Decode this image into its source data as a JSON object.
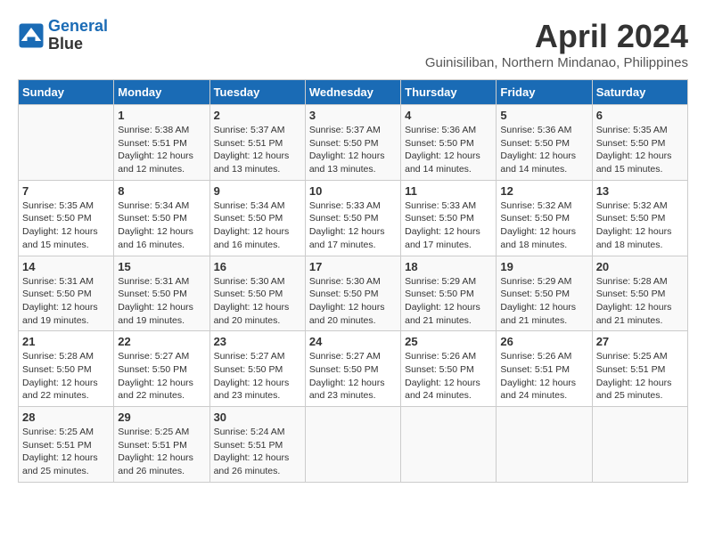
{
  "header": {
    "logo_line1": "General",
    "logo_line2": "Blue",
    "title": "April 2024",
    "subtitle": "Guinisiliban, Northern Mindanao, Philippines"
  },
  "weekdays": [
    "Sunday",
    "Monday",
    "Tuesday",
    "Wednesday",
    "Thursday",
    "Friday",
    "Saturday"
  ],
  "weeks": [
    [
      {
        "day": "",
        "sunrise": "",
        "sunset": "",
        "daylight": ""
      },
      {
        "day": "1",
        "sunrise": "Sunrise: 5:38 AM",
        "sunset": "Sunset: 5:51 PM",
        "daylight": "Daylight: 12 hours and 12 minutes."
      },
      {
        "day": "2",
        "sunrise": "Sunrise: 5:37 AM",
        "sunset": "Sunset: 5:51 PM",
        "daylight": "Daylight: 12 hours and 13 minutes."
      },
      {
        "day": "3",
        "sunrise": "Sunrise: 5:37 AM",
        "sunset": "Sunset: 5:50 PM",
        "daylight": "Daylight: 12 hours and 13 minutes."
      },
      {
        "day": "4",
        "sunrise": "Sunrise: 5:36 AM",
        "sunset": "Sunset: 5:50 PM",
        "daylight": "Daylight: 12 hours and 14 minutes."
      },
      {
        "day": "5",
        "sunrise": "Sunrise: 5:36 AM",
        "sunset": "Sunset: 5:50 PM",
        "daylight": "Daylight: 12 hours and 14 minutes."
      },
      {
        "day": "6",
        "sunrise": "Sunrise: 5:35 AM",
        "sunset": "Sunset: 5:50 PM",
        "daylight": "Daylight: 12 hours and 15 minutes."
      }
    ],
    [
      {
        "day": "7",
        "sunrise": "Sunrise: 5:35 AM",
        "sunset": "Sunset: 5:50 PM",
        "daylight": "Daylight: 12 hours and 15 minutes."
      },
      {
        "day": "8",
        "sunrise": "Sunrise: 5:34 AM",
        "sunset": "Sunset: 5:50 PM",
        "daylight": "Daylight: 12 hours and 16 minutes."
      },
      {
        "day": "9",
        "sunrise": "Sunrise: 5:34 AM",
        "sunset": "Sunset: 5:50 PM",
        "daylight": "Daylight: 12 hours and 16 minutes."
      },
      {
        "day": "10",
        "sunrise": "Sunrise: 5:33 AM",
        "sunset": "Sunset: 5:50 PM",
        "daylight": "Daylight: 12 hours and 17 minutes."
      },
      {
        "day": "11",
        "sunrise": "Sunrise: 5:33 AM",
        "sunset": "Sunset: 5:50 PM",
        "daylight": "Daylight: 12 hours and 17 minutes."
      },
      {
        "day": "12",
        "sunrise": "Sunrise: 5:32 AM",
        "sunset": "Sunset: 5:50 PM",
        "daylight": "Daylight: 12 hours and 18 minutes."
      },
      {
        "day": "13",
        "sunrise": "Sunrise: 5:32 AM",
        "sunset": "Sunset: 5:50 PM",
        "daylight": "Daylight: 12 hours and 18 minutes."
      }
    ],
    [
      {
        "day": "14",
        "sunrise": "Sunrise: 5:31 AM",
        "sunset": "Sunset: 5:50 PM",
        "daylight": "Daylight: 12 hours and 19 minutes."
      },
      {
        "day": "15",
        "sunrise": "Sunrise: 5:31 AM",
        "sunset": "Sunset: 5:50 PM",
        "daylight": "Daylight: 12 hours and 19 minutes."
      },
      {
        "day": "16",
        "sunrise": "Sunrise: 5:30 AM",
        "sunset": "Sunset: 5:50 PM",
        "daylight": "Daylight: 12 hours and 20 minutes."
      },
      {
        "day": "17",
        "sunrise": "Sunrise: 5:30 AM",
        "sunset": "Sunset: 5:50 PM",
        "daylight": "Daylight: 12 hours and 20 minutes."
      },
      {
        "day": "18",
        "sunrise": "Sunrise: 5:29 AM",
        "sunset": "Sunset: 5:50 PM",
        "daylight": "Daylight: 12 hours and 21 minutes."
      },
      {
        "day": "19",
        "sunrise": "Sunrise: 5:29 AM",
        "sunset": "Sunset: 5:50 PM",
        "daylight": "Daylight: 12 hours and 21 minutes."
      },
      {
        "day": "20",
        "sunrise": "Sunrise: 5:28 AM",
        "sunset": "Sunset: 5:50 PM",
        "daylight": "Daylight: 12 hours and 21 minutes."
      }
    ],
    [
      {
        "day": "21",
        "sunrise": "Sunrise: 5:28 AM",
        "sunset": "Sunset: 5:50 PM",
        "daylight": "Daylight: 12 hours and 22 minutes."
      },
      {
        "day": "22",
        "sunrise": "Sunrise: 5:27 AM",
        "sunset": "Sunset: 5:50 PM",
        "daylight": "Daylight: 12 hours and 22 minutes."
      },
      {
        "day": "23",
        "sunrise": "Sunrise: 5:27 AM",
        "sunset": "Sunset: 5:50 PM",
        "daylight": "Daylight: 12 hours and 23 minutes."
      },
      {
        "day": "24",
        "sunrise": "Sunrise: 5:27 AM",
        "sunset": "Sunset: 5:50 PM",
        "daylight": "Daylight: 12 hours and 23 minutes."
      },
      {
        "day": "25",
        "sunrise": "Sunrise: 5:26 AM",
        "sunset": "Sunset: 5:50 PM",
        "daylight": "Daylight: 12 hours and 24 minutes."
      },
      {
        "day": "26",
        "sunrise": "Sunrise: 5:26 AM",
        "sunset": "Sunset: 5:51 PM",
        "daylight": "Daylight: 12 hours and 24 minutes."
      },
      {
        "day": "27",
        "sunrise": "Sunrise: 5:25 AM",
        "sunset": "Sunset: 5:51 PM",
        "daylight": "Daylight: 12 hours and 25 minutes."
      }
    ],
    [
      {
        "day": "28",
        "sunrise": "Sunrise: 5:25 AM",
        "sunset": "Sunset: 5:51 PM",
        "daylight": "Daylight: 12 hours and 25 minutes."
      },
      {
        "day": "29",
        "sunrise": "Sunrise: 5:25 AM",
        "sunset": "Sunset: 5:51 PM",
        "daylight": "Daylight: 12 hours and 26 minutes."
      },
      {
        "day": "30",
        "sunrise": "Sunrise: 5:24 AM",
        "sunset": "Sunset: 5:51 PM",
        "daylight": "Daylight: 12 hours and 26 minutes."
      },
      {
        "day": "",
        "sunrise": "",
        "sunset": "",
        "daylight": ""
      },
      {
        "day": "",
        "sunrise": "",
        "sunset": "",
        "daylight": ""
      },
      {
        "day": "",
        "sunrise": "",
        "sunset": "",
        "daylight": ""
      },
      {
        "day": "",
        "sunrise": "",
        "sunset": "",
        "daylight": ""
      }
    ]
  ]
}
